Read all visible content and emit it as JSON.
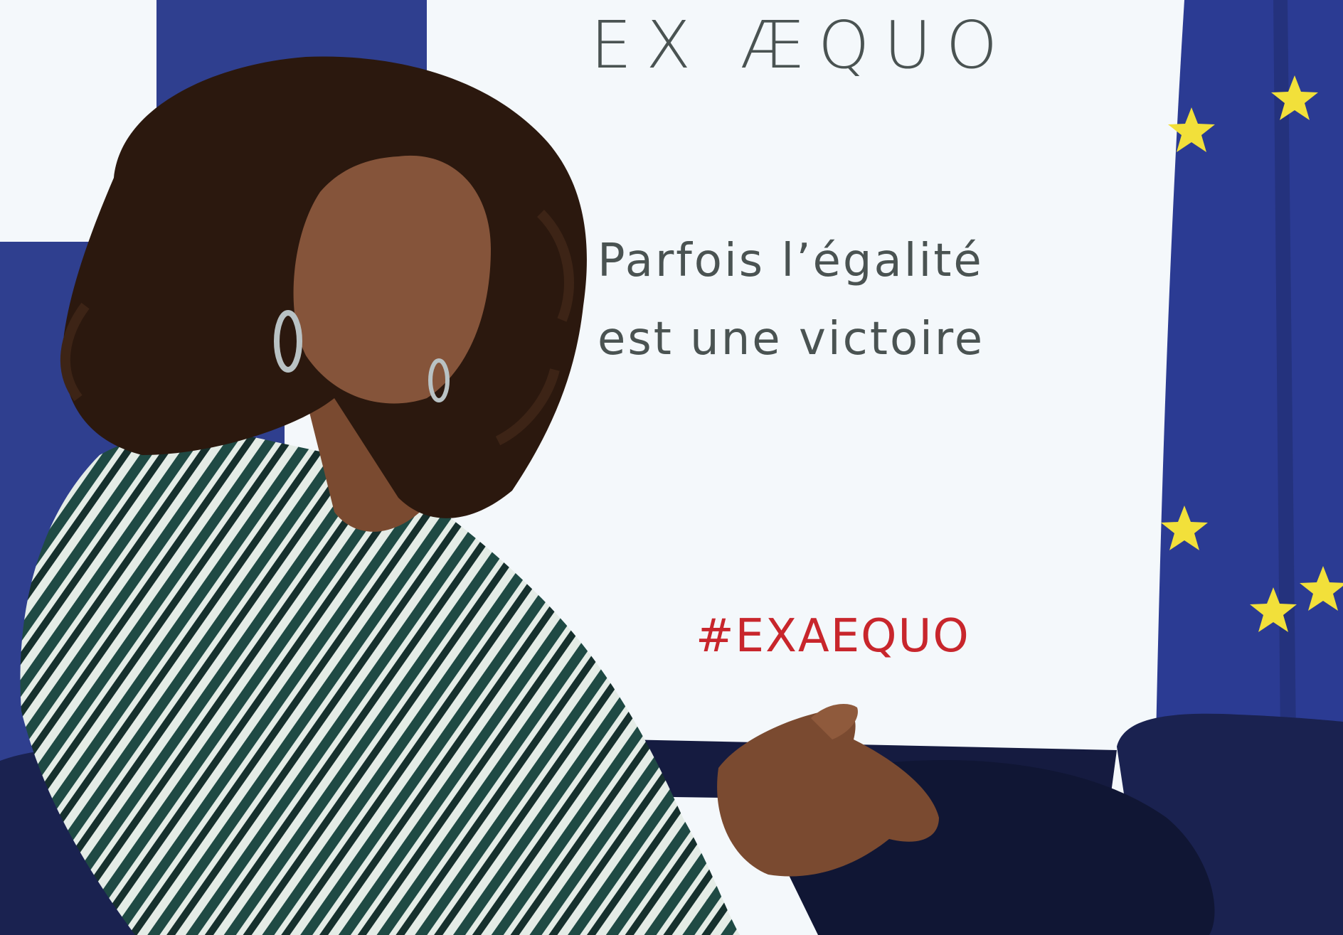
{
  "poster": {
    "title": "EX ÆQUO",
    "tagline_line1": "Parfois l’égalité",
    "tagline_line2": "est une victoire",
    "hashtag": "#EXAEQUO"
  },
  "colors": {
    "panel_blue": "#2f3f8f",
    "screen_white": "#f4f8fb",
    "eu_flag_blue": "#2b3b93",
    "star_yellow": "#f2e03a",
    "title_text": "#4a5352",
    "hashtag_red": "#c8262c",
    "chair_navy": "#1a2250",
    "hair_brown": "#2b180e",
    "skin_brown": "#85543a",
    "stripe_green": "#1f4a44",
    "stripe_white": "#e4ece6"
  },
  "icons": [
    "eu-star-icon"
  ]
}
